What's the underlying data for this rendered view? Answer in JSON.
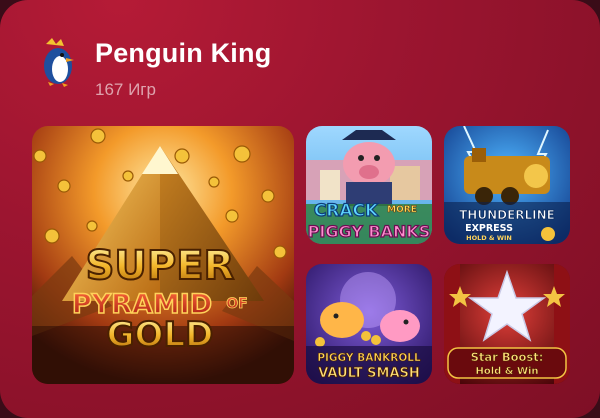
{
  "provider": {
    "name": "Penguin King",
    "games_count": "167 Игр",
    "logo_icon": "penguin-king-logo-icon"
  },
  "games": [
    {
      "id": "super-pyramid-of-gold",
      "title_line1": "SUPER",
      "title_line2": "PYRAMID",
      "title_of": "OF",
      "title_line3": "GOLD"
    },
    {
      "id": "crack-more-piggy-banks",
      "title_line1": "CRACK",
      "title_more": "MORE",
      "title_line2": "PIGGY BANKS"
    },
    {
      "id": "thunderline-express",
      "title_line1": "THUNDERLINE",
      "title_line2": "EXPRESS",
      "title_line3": "HOLD & WIN"
    },
    {
      "id": "piggy-bankroll-vault-smash",
      "title_line1": "PIGGY BANKROLL",
      "title_line2": "VAULT SMASH"
    },
    {
      "id": "star-boost",
      "title_line1": "Star Boost:",
      "title_line2": "Hold & Win"
    }
  ],
  "colors": {
    "background": "#9c1530",
    "text": "#ffffff",
    "muted": "#d9a9b3"
  }
}
